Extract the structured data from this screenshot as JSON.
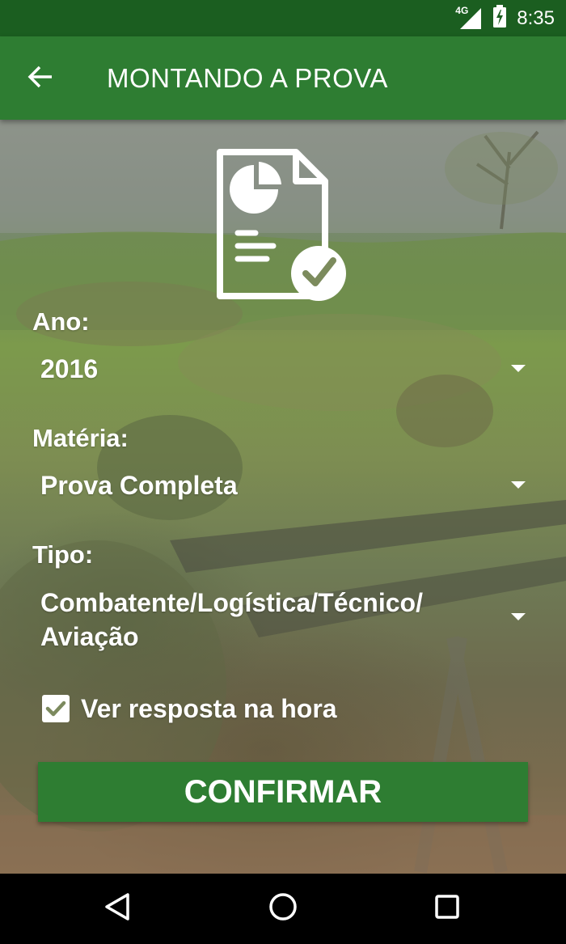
{
  "status_bar": {
    "network": "4G",
    "time": "8:35"
  },
  "app_bar": {
    "title": "MONTANDO A PROVA",
    "back_icon": "arrow-left-icon"
  },
  "form": {
    "header_icon": "exam-document-chart-check-icon",
    "ano": {
      "label": "Ano:",
      "value": "2016"
    },
    "materia": {
      "label": "Matéria:",
      "value": "Prova Completa"
    },
    "tipo": {
      "label": "Tipo:",
      "value_line1": "Combatente/Logística/Técnico/",
      "value_line2": "Aviação"
    },
    "show_answer": {
      "label": "Ver resposta na hora",
      "checked": true
    },
    "confirm_label": "CONFIRMAR"
  },
  "colors": {
    "status_bar": "#1b5e20",
    "primary": "#2e7d32",
    "nav_bar": "#000000"
  },
  "nav_bar": {
    "back_icon": "triangle-back-icon",
    "home_icon": "circle-home-icon",
    "recents_icon": "square-recents-icon"
  }
}
